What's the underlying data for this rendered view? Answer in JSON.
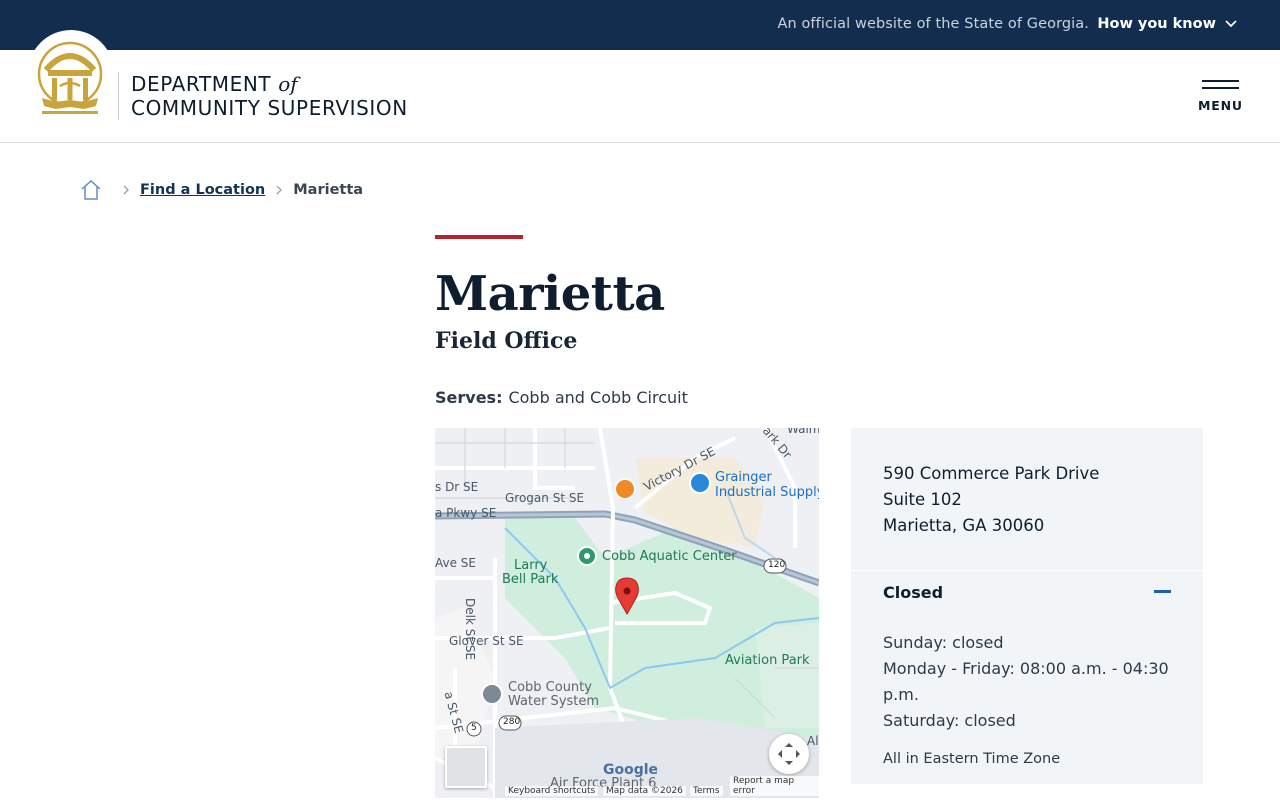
{
  "topbar": {
    "official_text": "An official website of the State of Georgia.",
    "how_label": "How you know"
  },
  "header": {
    "dept_line1": "DEPARTMENT",
    "dept_of": "of",
    "dept_line2": "COMMUNITY SUPERVISION",
    "menu_label": "MENU"
  },
  "breadcrumb": {
    "link": "Find a Location",
    "current": "Marietta"
  },
  "page": {
    "title": "Marietta",
    "subtitle": "Field Office",
    "serves_label": "Serves:",
    "serves_value": "Cobb and Cobb Circuit"
  },
  "map": {
    "labels": {
      "grogan": "Grogan St SE",
      "victory": "Victory Dr SE",
      "parkdr": "Park Dr",
      "walm": "Walm",
      "drse": "s Dr SE",
      "pkwy": "a Pkwy SE",
      "avese": "Ave SE",
      "delk": "Delk St SE",
      "glover": "Glover St SE",
      "stse": "a St SE",
      "grainger1": "Grainger",
      "grainger2": "Industrial Supply",
      "cobb_aquatic": "Cobb Aquatic Center",
      "larry1": "Larry",
      "larry2": "Bell Park",
      "aviation": "Aviation Park",
      "water1": "Cobb County",
      "water2": "Water System",
      "airforce": "Air Force Plant 6",
      "shield120": "120",
      "shield280": "280",
      "shield5": "5",
      "ali": "Ali",
      "google": "Google"
    },
    "footer": {
      "shortcuts": "Keyboard shortcuts",
      "mapdata": "Map data ©2026",
      "terms": "Terms",
      "report": "Report a map error"
    }
  },
  "location": {
    "address_line1": "590 Commerce Park Drive",
    "address_line2": "Suite 102",
    "address_line3": "Marietta, GA 30060",
    "status": "Closed",
    "hours": [
      "Sunday: closed",
      "Monday - Friday: 08:00 a.m. - 04:30 p.m.",
      "Saturday: closed"
    ],
    "timezone": "All in Eastern Time Zone"
  },
  "colors": {
    "navy": "#122d4d",
    "accent_red": "#b5242f",
    "gold": "#c9a43a",
    "card_bg": "#f2f5f8",
    "link_blue": "#1f5fa8"
  },
  "icons": [
    "chevron-down-icon",
    "georgia-seal-icon",
    "hamburger-menu-icon",
    "home-icon",
    "chevron-right-icon",
    "map-pin-icon",
    "fullscreen-icon",
    "minus-icon"
  ]
}
